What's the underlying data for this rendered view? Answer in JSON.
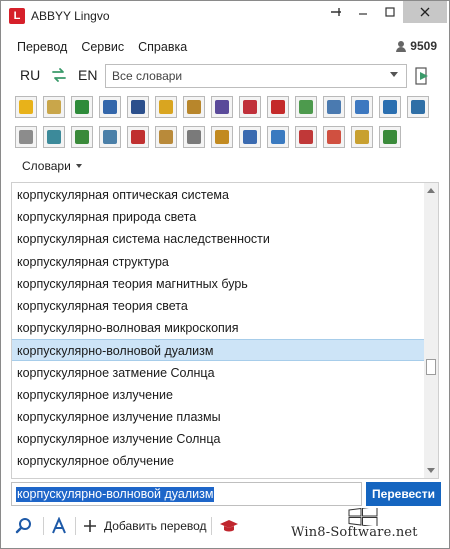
{
  "window": {
    "title": "ABBYY Lingvo",
    "logo_letter": "L"
  },
  "menu": {
    "items": [
      {
        "label": "Перевод"
      },
      {
        "label": "Сервис"
      },
      {
        "label": "Справка"
      }
    ],
    "counter": "9509"
  },
  "language": {
    "source": "RU",
    "target": "EN",
    "dictionaries_placeholder": "Все словари"
  },
  "dict_toolbar": {
    "icons": [
      {
        "name": "dict-icon-book",
        "color": "#e8b21a"
      },
      {
        "name": "dict-icon-notes",
        "color": "#c9a64a"
      },
      {
        "name": "dict-icon-globe",
        "color": "#2e8b3a"
      },
      {
        "name": "dict-icon-question",
        "color": "#3366aa"
      },
      {
        "name": "dict-icon-calculator",
        "color": "#2b4f8c"
      },
      {
        "name": "dict-icon-coin",
        "color": "#d9a520"
      },
      {
        "name": "dict-icon-scales",
        "color": "#b8862b"
      },
      {
        "name": "dict-icon-person",
        "color": "#5a4a9a"
      },
      {
        "name": "dict-icon-heart",
        "color": "#c0303a"
      },
      {
        "name": "dict-icon-magnet",
        "color": "#c42a2a"
      },
      {
        "name": "dict-icon-flask",
        "color": "#4d9a4d"
      },
      {
        "name": "dict-icon-microscope",
        "color": "#4a7ab0"
      },
      {
        "name": "dict-icon-head",
        "color": "#3d78c0"
      },
      {
        "name": "dict-icon-world",
        "color": "#2b6fb0"
      },
      {
        "name": "dict-icon-monitor",
        "color": "#2f6fa6"
      },
      {
        "name": "dict-icon-cd",
        "color": "#8c8c8c"
      },
      {
        "name": "dict-icon-gear-globe",
        "color": "#3c8a9a"
      },
      {
        "name": "dict-icon-tractor",
        "color": "#3a8a3a"
      },
      {
        "name": "dict-icon-cogs",
        "color": "#4a7fa8"
      },
      {
        "name": "dict-icon-car",
        "color": "#c03030"
      },
      {
        "name": "dict-icon-building",
        "color": "#b98a3a"
      },
      {
        "name": "dict-icon-documents",
        "color": "#7a7a7a"
      },
      {
        "name": "dict-icon-trophy",
        "color": "#c28a20"
      },
      {
        "name": "dict-icon-ball",
        "color": "#3a6ab0"
      },
      {
        "name": "dict-icon-chat",
        "color": "#3a7ac0"
      },
      {
        "name": "dict-icon-ab",
        "color": "#c03838"
      },
      {
        "name": "dict-icon-open-book",
        "color": "#d05040"
      },
      {
        "name": "dict-icon-house",
        "color": "#c8a030"
      },
      {
        "name": "dict-icon-add",
        "color": "#3a8a3a"
      }
    ]
  },
  "dictionaries_menu": "Словари",
  "wordlist": {
    "items": [
      "корпускулярная оптическая система",
      "корпускулярная природа света",
      "корпускулярная система наследственности",
      "корпускулярная структура",
      "корпускулярная теория магнитных бурь",
      "корпускулярная теория света",
      "корпускулярно-волновая микроскопия",
      "корпускулярно-волновой дуализм",
      "корпускулярное затмение Солнца",
      "корпускулярное излучение",
      "корпускулярное излучение плазмы",
      "корпускулярное излучение Солнца",
      "корпускулярное облучение"
    ],
    "selected_index": 7
  },
  "search": {
    "value": "корпускулярно-волновой дуализм",
    "translate_label": "Перевести"
  },
  "bottom": {
    "add_translation_label": "Добавить перевод"
  },
  "watermark": "Win8-Software.net"
}
